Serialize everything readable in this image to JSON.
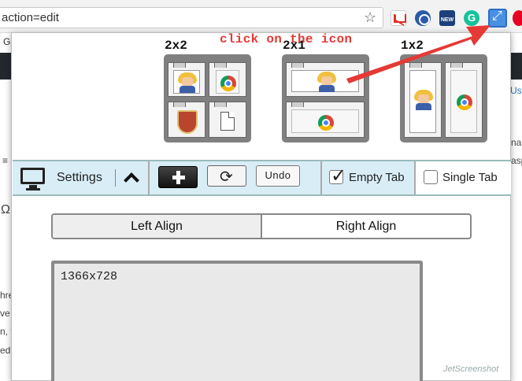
{
  "browser": {
    "address_text": "action=edit",
    "extensions": [
      "gmail-icon",
      "rss-reader-icon",
      "news-icon",
      "grammarly-icon",
      "tab-resize-icon",
      "pinterest-icon"
    ],
    "grammarly_letter": "G",
    "news_label": "NEW"
  },
  "background_page": {
    "fragments": [
      "G",
      "Usec",
      "nar",
      "asp",
      "Ω",
      "hre",
      "ve c",
      "n, t",
      "ed",
      "≡"
    ]
  },
  "annotation": {
    "text": "click on the icon",
    "color": "#e53935"
  },
  "layouts": [
    {
      "label": "2x2"
    },
    {
      "label": "2x1"
    },
    {
      "label": "1x2"
    }
  ],
  "toolbar": {
    "settings_label": "Settings",
    "undo_label": "Undo",
    "refresh_symbol": "⟳",
    "empty_tab_label": "Empty Tab",
    "empty_tab_checked": true,
    "single_tab_label": "Single Tab",
    "single_tab_checked": false,
    "background": "#d9edf7"
  },
  "align": {
    "left_label": "Left Align",
    "right_label": "Right Align",
    "selected": "left"
  },
  "resolution": {
    "value": "1366x728"
  },
  "watermark": "JetScreenshot"
}
